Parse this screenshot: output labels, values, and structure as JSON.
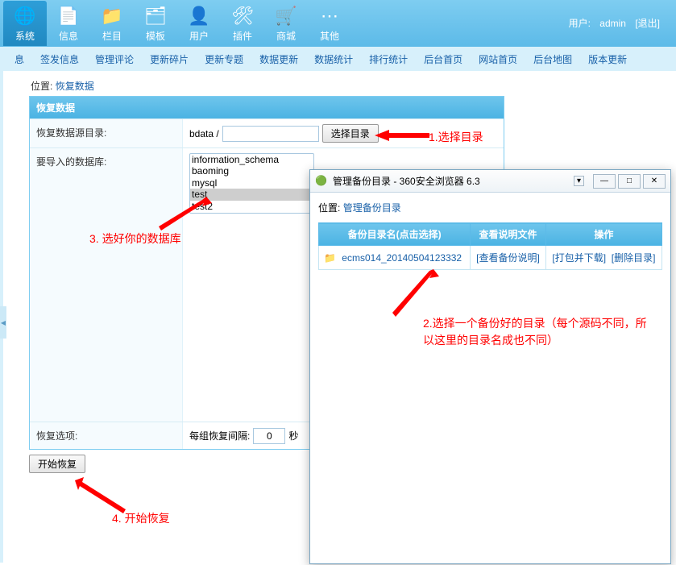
{
  "nav": {
    "items": [
      {
        "label": "系统",
        "icon": "🌐"
      },
      {
        "label": "信息",
        "icon": "📄"
      },
      {
        "label": "栏目",
        "icon": "📁"
      },
      {
        "label": "模板",
        "icon": "🗂"
      },
      {
        "label": "用户",
        "icon": "👤"
      },
      {
        "label": "插件",
        "icon": "✂"
      },
      {
        "label": "商城",
        "icon": "🛒"
      },
      {
        "label": "其他",
        "icon": "⋯"
      }
    ]
  },
  "user": {
    "prefix": "用户:",
    "name": "admin",
    "logout": "[退出]"
  },
  "submenu": [
    "息",
    "签发信息",
    "管理评论",
    "更新碎片",
    "更新专题",
    "数据更新",
    "数据统计",
    "排行统计",
    "后台首页",
    "网站首页",
    "后台地图",
    "版本更新"
  ],
  "breadcrumb": {
    "prefix": "位置:",
    "link": "恢复数据"
  },
  "panel": {
    "title": "恢复数据",
    "source_label": "恢复数据源目录:",
    "source_prefix": "bdata /",
    "source_value": "",
    "choose_dir_btn": "选择目录",
    "import_label": "要导入的数据库:",
    "databases": [
      "information_schema",
      "baoming",
      "mysql",
      "test",
      "test2"
    ],
    "selected_db": "test",
    "restore_options_label": "恢复选项:",
    "interval_label": "每组恢复间隔:",
    "interval_value": "0",
    "interval_unit": "秒",
    "submit": "开始恢复"
  },
  "popup": {
    "title_prefix": "管理备份目录",
    "title_suffix": " - 360安全浏览器 6.3",
    "breadcrumb_prefix": "位置:",
    "breadcrumb_link": "管理备份目录",
    "headers": [
      "备份目录名(点击选择)",
      "查看说明文件",
      "操作"
    ],
    "row": {
      "name": "ecms014_20140504123332",
      "view": "[查看备份说明]",
      "op1": "[打包并下载]",
      "op2": "[删除目录]"
    }
  },
  "annotations": {
    "a1": "1.选择目录",
    "a2": "2.选择一个备份好的目录（每个源码不同，所以这里的目录名成也不同）",
    "a3": "3.  选好你的数据库",
    "a4": "4. 开始恢复"
  }
}
